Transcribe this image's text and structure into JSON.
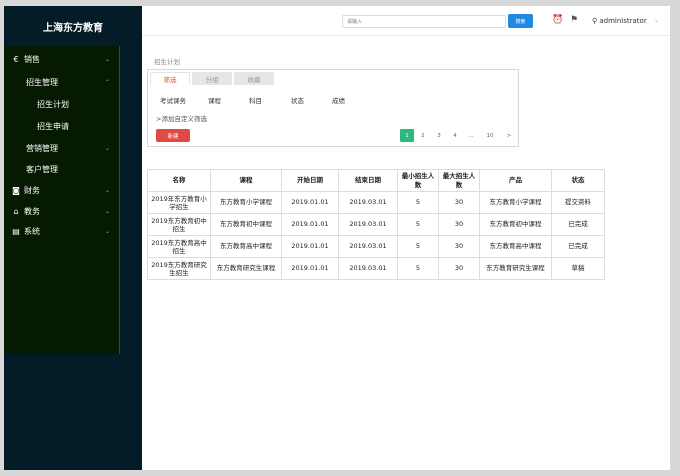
{
  "brand": "上海东方教育",
  "sidebar": {
    "items": [
      {
        "icon": "€",
        "icon_name": "euro-icon",
        "label": "销售",
        "chevron": "⌄"
      },
      {
        "label": "招生管理",
        "chevron": "⌃"
      },
      {
        "label": "招生计划"
      },
      {
        "label": "招生申请"
      },
      {
        "label": "营销管理",
        "chevron": "⌄"
      },
      {
        "label": "客户管理"
      },
      {
        "icon": "◙",
        "icon_name": "finance-icon",
        "label": "财务",
        "chevron": "⌄"
      },
      {
        "icon": "⌂",
        "icon_name": "bank-icon",
        "label": "教务",
        "chevron": "⌄"
      },
      {
        "icon": "▤",
        "icon_name": "system-icon",
        "label": "系统",
        "chevron": "⌄"
      }
    ]
  },
  "header": {
    "search_placeholder": "请输入",
    "search_button": "搜索",
    "alarm_icon": "⏰",
    "message_icon": "⚑",
    "user_icon": "⚲",
    "username": "administrator",
    "user_chevron": "⌄"
  },
  "breadcrumb": "招生计划",
  "filters": {
    "tabs": [
      {
        "label": "筛选",
        "active": true
      },
      {
        "label": "分组",
        "active": false
      },
      {
        "label": "收藏",
        "active": false
      }
    ],
    "fields": [
      "考试课务",
      "课程",
      "科目",
      "状态",
      "成绩"
    ],
    "add_custom": ">添加自定义筛选",
    "new_button": "新建",
    "pagination": [
      "1",
      "2",
      "3",
      "4",
      "...",
      "10",
      ">"
    ]
  },
  "table": {
    "headers": [
      "名称",
      "课程",
      "开始日期",
      "结束日期",
      "最小招生人数",
      "最大招生人数",
      "产品",
      "状态"
    ],
    "rows": [
      [
        "2019年东方教育小学招生",
        "东方教育小学课程",
        "2019.01.01",
        "2019.03.01",
        "5",
        "30",
        "东方教育小学课程",
        "提交资料"
      ],
      [
        "2019东方教育初中招生",
        "东方教育初中课程",
        "2019.01.01",
        "2019.03.01",
        "5",
        "30",
        "东方教育初中课程",
        "已完成"
      ],
      [
        "2019东方教育高中招生",
        "东方教育高中课程",
        "2019.01.01",
        "2019.03.01",
        "5",
        "30",
        "东方教育高中课程",
        "已完成"
      ],
      [
        "2019东方教育研究生招生",
        "东方教育研究生课程",
        "2019.01.01",
        "2019.03.01",
        "5",
        "30",
        "东方教育研究生课程",
        "草稿"
      ]
    ]
  }
}
